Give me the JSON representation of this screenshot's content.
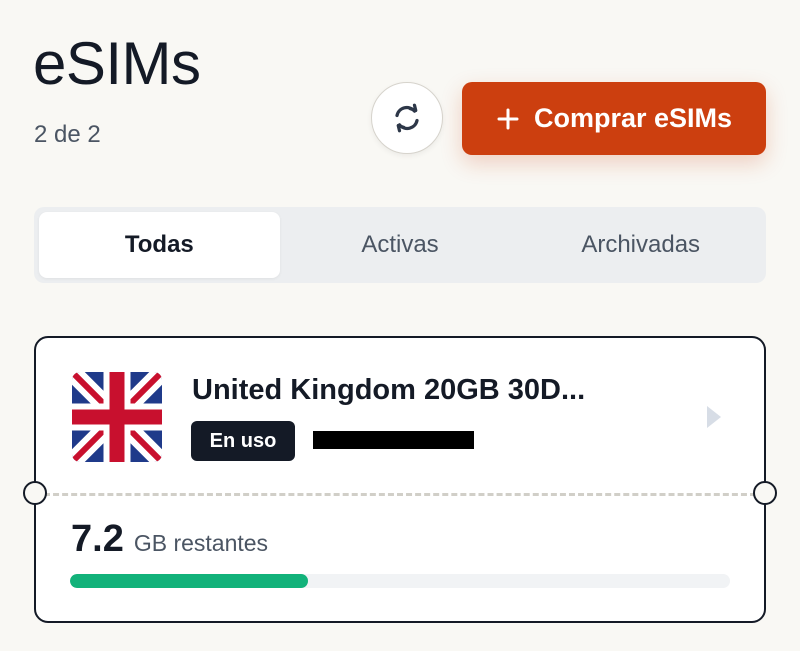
{
  "header": {
    "title": "eSIMs",
    "count": "2 de 2",
    "refresh_icon": "refresh-icon",
    "buy_label": "Comprar eSIMs",
    "buy_icon": "plus-icon"
  },
  "tabs": [
    {
      "label": "Todas",
      "active": true
    },
    {
      "label": "Activas",
      "active": false
    },
    {
      "label": "Archivadas",
      "active": false
    }
  ],
  "esim_card": {
    "flag_icon": "uk-flag-icon",
    "plan_name": "United Kingdom 20GB 30D...",
    "status": "En uso",
    "chevron_icon": "chevron-right-icon",
    "remaining_value": "7.2",
    "remaining_label": "GB restantes",
    "usage_progress": 0.36
  },
  "colors": {
    "accent": "#cc3f0f",
    "progress": "#12b27a",
    "dark": "#141a26",
    "background": "#f9f8f4"
  }
}
